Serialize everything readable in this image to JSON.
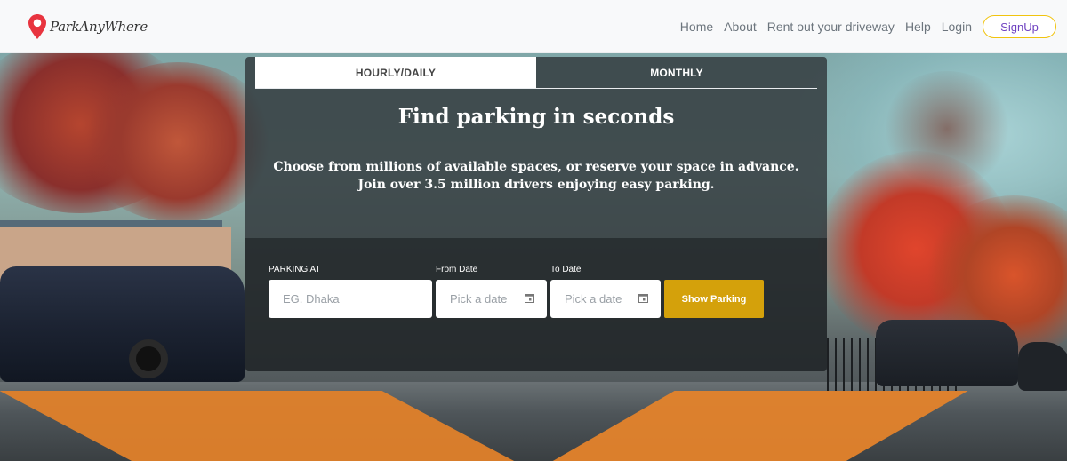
{
  "brand": {
    "name": "ParkAnyWhere"
  },
  "nav": {
    "links": [
      "Home",
      "About",
      "Rent out your driveway",
      "Help",
      "Login"
    ],
    "signup_label": "SignUp"
  },
  "tabs": [
    {
      "label": "HOURLY/DAILY",
      "active": true
    },
    {
      "label": "MONTHLY",
      "active": false
    }
  ],
  "hero": {
    "headline": "Find parking in seconds",
    "subtext_line1": "Choose from millions of available spaces, or reserve your space in advance.",
    "subtext_line2": "Join over 3.5 million drivers enjoying easy parking."
  },
  "search": {
    "location_label": "PARKING AT",
    "location_placeholder": "EG. Dhaka",
    "from_label": "From Date",
    "from_placeholder": "Pick a date",
    "to_label": "To Date",
    "to_placeholder": "Pick a date",
    "submit_label": "Show Parking"
  },
  "colors": {
    "accent": "#d4a10b",
    "signup_border": "#f1c40f",
    "signup_text": "#6f42c1",
    "brand_pin": "#e8343f",
    "panel": "#343c40"
  },
  "icons": {
    "brand": "location-pin-icon",
    "date": "calendar-icon"
  }
}
